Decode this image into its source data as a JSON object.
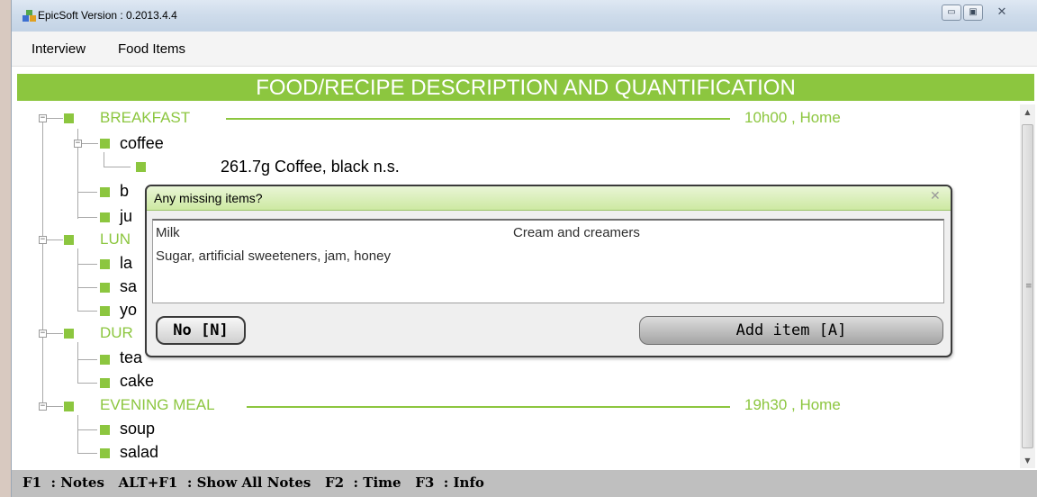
{
  "window": {
    "title": "EpicSoft Version : 0.2013.4.4",
    "minimize_glyph": "▭",
    "maximize_glyph": "▣",
    "close_glyph": "✕"
  },
  "menu": [
    {
      "label": "Interview"
    },
    {
      "label": "Food Items"
    }
  ],
  "banner": {
    "title": "FOOD/RECIPE DESCRIPTION AND QUANTIFICATION",
    "color": "#8cc63f"
  },
  "tree": {
    "breakfast": {
      "name": "BREAKFAST",
      "time": "10h00 , Home",
      "items": [
        {
          "label": "coffee"
        },
        {
          "label": "b"
        },
        {
          "label": "ju"
        }
      ],
      "detail": "261.7g Coffee, black n.s."
    },
    "lunch": {
      "name": "LUN",
      "items": [
        {
          "label": "la"
        },
        {
          "label": "sa"
        },
        {
          "label": "yo"
        }
      ]
    },
    "dur": {
      "name": "DUR",
      "items": [
        {
          "label": "tea"
        },
        {
          "label": "cake"
        }
      ]
    },
    "evening": {
      "name": "EVENING MEAL",
      "time": "19h30 , Home",
      "items": [
        {
          "label": "soup"
        },
        {
          "label": "salad"
        }
      ]
    }
  },
  "dialog": {
    "title": "Any missing items?",
    "close_glyph": "✕",
    "options": [
      {
        "label": "Milk"
      },
      {
        "label": "Cream and creamers"
      },
      {
        "label": "Sugar, artificial sweeteners, jam, honey"
      }
    ],
    "no_button": "No [N]",
    "add_button": "Add item [A]"
  },
  "status_bar": {
    "text": "F1  : Notes   ALT+F1  : Show All Notes   F2  : Time   F3  : Info"
  },
  "scrollbar": {
    "up_glyph": "▲",
    "down_glyph": "▼",
    "grip_glyph": "≡"
  }
}
